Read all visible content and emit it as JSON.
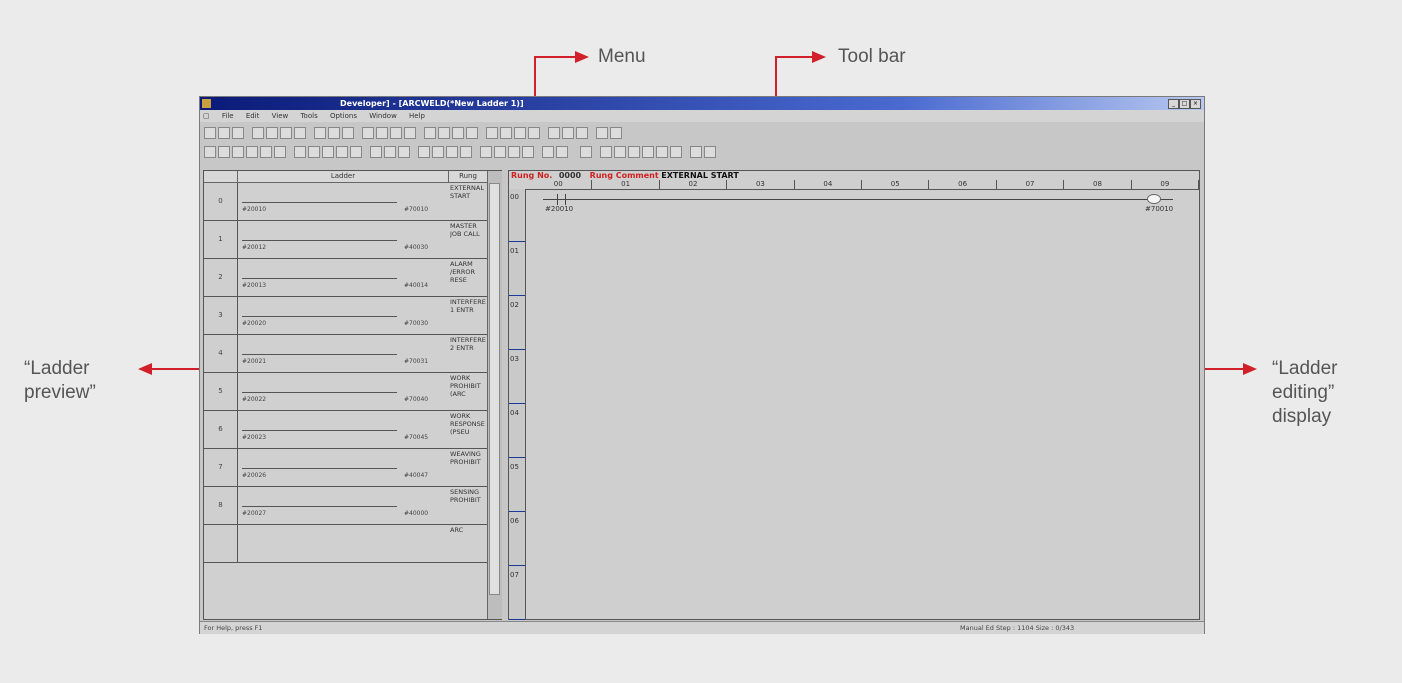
{
  "callouts": {
    "menu": "Menu",
    "toolbar": "Tool bar",
    "preview_line1": "“Ladder",
    "preview_line2": "preview”",
    "editing_line1": "“Ladder",
    "editing_line2": "editing”",
    "editing_line3": "display"
  },
  "window": {
    "title": "Developer] - [ARCWELD(*New Ladder 1)]",
    "menu": [
      "File",
      "Edit",
      "View",
      "Tools",
      "Options",
      "Window",
      "Help"
    ],
    "status_left": "For Help, press F1",
    "status_right": "Manual Ed  Step : 1104  Size : 0/343"
  },
  "preview": {
    "col_ladder": "Ladder",
    "col_rung": "Rung",
    "rows": [
      {
        "num": "0",
        "in": "#20010",
        "out": "#70010",
        "comment": "EXTERNAL START"
      },
      {
        "num": "1",
        "in": "#20012",
        "out": "#40030",
        "comment": "MASTER JOB CALL"
      },
      {
        "num": "2",
        "in": "#20013",
        "out": "#40014",
        "comment": "ALARM /ERROR RESE"
      },
      {
        "num": "3",
        "in": "#20020",
        "out": "#70030",
        "comment": "INTERFERENCE 1 ENTR"
      },
      {
        "num": "4",
        "in": "#20021",
        "out": "#70031",
        "comment": "INTERFERENCE 2 ENTR"
      },
      {
        "num": "5",
        "in": "#20022",
        "out": "#70040",
        "comment": "WORK PROHIBIT (ARC"
      },
      {
        "num": "6",
        "in": "#20023",
        "out": "#70045",
        "comment": "WORK RESPONSE (PSEU"
      },
      {
        "num": "7",
        "in": "#20026",
        "out": "#40047",
        "comment": "WEAVING PROHIBIT"
      },
      {
        "num": "8",
        "in": "#20027",
        "out": "#40000",
        "comment": "SENSING PROHIBIT"
      },
      {
        "num": "",
        "in": "",
        "out": "",
        "comment": "ARC"
      }
    ]
  },
  "editor": {
    "rung_no_label": "Rung No.",
    "rung_no": "0000",
    "rung_comment_label": "Rung Comment",
    "rung_comment": "EXTERNAL START",
    "columns": [
      "00",
      "01",
      "02",
      "03",
      "04",
      "05",
      "06",
      "07",
      "08",
      "09"
    ],
    "rows": [
      "00",
      "01",
      "02",
      "03",
      "04",
      "05",
      "06",
      "07"
    ],
    "contact": "#20010",
    "coil": "#70010"
  }
}
